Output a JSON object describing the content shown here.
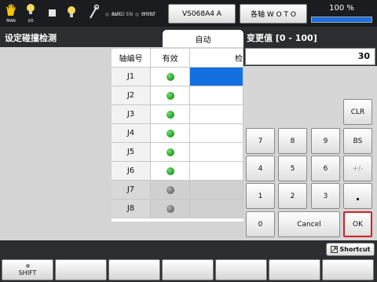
{
  "status_bar": {
    "icons": [
      {
        "name": "hand-icon",
        "label": "MAN"
      },
      {
        "name": "lightbulb-icon",
        "label": "I/O"
      },
      {
        "name": "stop-square-icon",
        "label": ""
      },
      {
        "name": "lamp-icon",
        "label": ""
      },
      {
        "name": "wrench-icon",
        "label": ""
      }
    ],
    "indicators_left": [
      "EMG",
      "AUTO EN"
    ],
    "indicators_right": [
      "PRTCT",
      "D SW"
    ],
    "robot_button": "VS068A4 A",
    "axis_button": "各轴 W O T O",
    "speed_text": "100 %",
    "speed_fraction": 1.0
  },
  "page": {
    "title": "设定碰撞检测",
    "mode_tab": "自动"
  },
  "table": {
    "headers": [
      "轴编号",
      "有效",
      "检"
    ],
    "rows": [
      {
        "axis": "J1",
        "enabled": true
      },
      {
        "axis": "J2",
        "enabled": true
      },
      {
        "axis": "J3",
        "enabled": true
      },
      {
        "axis": "J4",
        "enabled": true
      },
      {
        "axis": "J5",
        "enabled": true
      },
      {
        "axis": "J6",
        "enabled": true
      },
      {
        "axis": "J7",
        "enabled": false
      },
      {
        "axis": "J8",
        "enabled": false
      }
    ]
  },
  "keypad": {
    "title": "变更值 [0 - 100]",
    "value": "30",
    "clr": "CLR",
    "bs": "BS",
    "sign": "+/-",
    "dot": ".",
    "cancel": "Cancel",
    "ok": "OK",
    "digits": [
      "7",
      "8",
      "9",
      "4",
      "5",
      "6",
      "1",
      "2",
      "3",
      "0"
    ]
  },
  "footer": {
    "shortcut": "Shortcut",
    "shift": "SHIFT"
  },
  "colors": {
    "dark_panel": "#2b2d31",
    "selected_cell": "#1470e0",
    "ok_border": "#d42020",
    "led_on": "#1f9a1f"
  }
}
